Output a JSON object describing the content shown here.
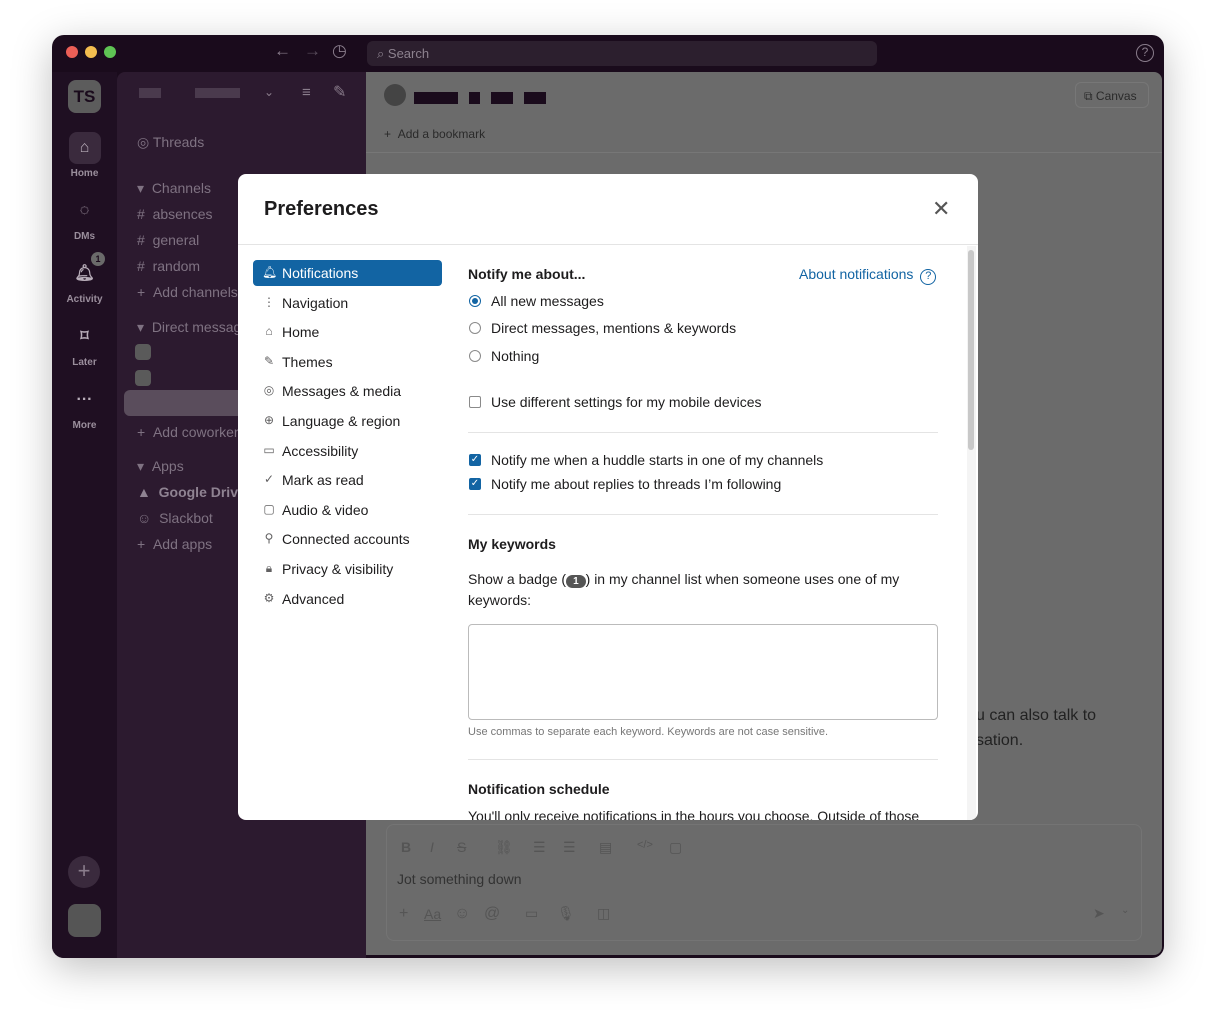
{
  "titlebar": {
    "search_placeholder": "Search",
    "help_icon": "?"
  },
  "rail": {
    "workspace_initials": "TS",
    "items": [
      {
        "label": "Home"
      },
      {
        "label": "DMs"
      },
      {
        "label": "Activity",
        "badge": "1"
      },
      {
        "label": "Later"
      },
      {
        "label": "More"
      }
    ]
  },
  "sidebar": {
    "threads": "Threads",
    "channels_header": "Channels",
    "channels": [
      "absences",
      "general",
      "random"
    ],
    "add_channels": "Add channels",
    "dm_header": "Direct messages",
    "add_coworkers": "Add coworkers",
    "apps_header": "Apps",
    "apps": [
      "Google Drive",
      "Slackbot"
    ],
    "add_apps": "Add apps"
  },
  "main": {
    "add_bookmark": "Add a bookmark",
    "canvas": "Canvas",
    "composer_placeholder": "Jot something down",
    "partial_text": [
      "u can also talk to",
      "sation."
    ]
  },
  "dialog": {
    "title": "Preferences",
    "nav": [
      {
        "label": "Notifications",
        "icon": "bell-icon",
        "selected": true
      },
      {
        "label": "Navigation",
        "icon": "navigation-icon"
      },
      {
        "label": "Home",
        "icon": "home-icon"
      },
      {
        "label": "Themes",
        "icon": "brush-icon"
      },
      {
        "label": "Messages & media",
        "icon": "message-icon"
      },
      {
        "label": "Language & region",
        "icon": "globe-icon"
      },
      {
        "label": "Accessibility",
        "icon": "laptop-icon"
      },
      {
        "label": "Mark as read",
        "icon": "check-circle-icon"
      },
      {
        "label": "Audio & video",
        "icon": "video-icon"
      },
      {
        "label": "Connected accounts",
        "icon": "plug-icon"
      },
      {
        "label": "Privacy & visibility",
        "icon": "lock-icon"
      },
      {
        "label": "Advanced",
        "icon": "gear-icon"
      }
    ],
    "notify_heading": "Notify me about...",
    "about_link": "About notifications",
    "radios": [
      {
        "label": "All new messages",
        "checked": true
      },
      {
        "label": "Direct messages, mentions & keywords",
        "checked": false
      },
      {
        "label": "Nothing",
        "checked": false
      }
    ],
    "mobile_checkbox": {
      "label": "Use different settings for my mobile devices",
      "checked": false
    },
    "checkboxes": [
      {
        "label": "Notify me when a huddle starts in one of my channels",
        "checked": true
      },
      {
        "label": "Notify me about replies to threads I’m following",
        "checked": true
      }
    ],
    "keywords_heading": "My keywords",
    "keywords_desc_pre": "Show a badge (",
    "keywords_badge": "1",
    "keywords_desc_post": ") in my channel list when someone uses one of my",
    "keywords_desc_line2": "keywords:",
    "keywords_value": "",
    "keywords_hint": "Use commas to separate each keyword. Keywords are not case sensitive.",
    "schedule_heading": "Notification schedule",
    "schedule_desc": "You'll only receive notifications in the hours you choose. Outside of those"
  }
}
